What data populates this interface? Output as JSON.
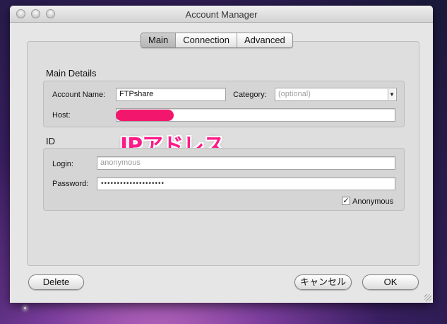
{
  "window": {
    "title": "Account Manager"
  },
  "tabs": [
    {
      "label": "Main",
      "active": true
    },
    {
      "label": "Connection",
      "active": false
    },
    {
      "label": "Advanced",
      "active": false
    }
  ],
  "main_details": {
    "title": "Main Details",
    "account_name_label": "Account Name:",
    "account_name_value": "FTPshare",
    "category_label": "Category:",
    "category_placeholder": "(optional)",
    "host_label": "Host:",
    "host_value": ""
  },
  "annotation": {
    "text": "IPアドレス",
    "color": "#ff1a88"
  },
  "id_section": {
    "title": "ID",
    "login_label": "Login:",
    "login_value": "anonymous",
    "password_label": "Password:",
    "password_value": "••••••••••••••••••••",
    "anonymous_label": "Anonymous",
    "anonymous_checked": true
  },
  "buttons": {
    "delete": "Delete",
    "cancel": "キャンセル",
    "ok": "OK"
  },
  "colors": {
    "redaction": "#f2176c"
  }
}
